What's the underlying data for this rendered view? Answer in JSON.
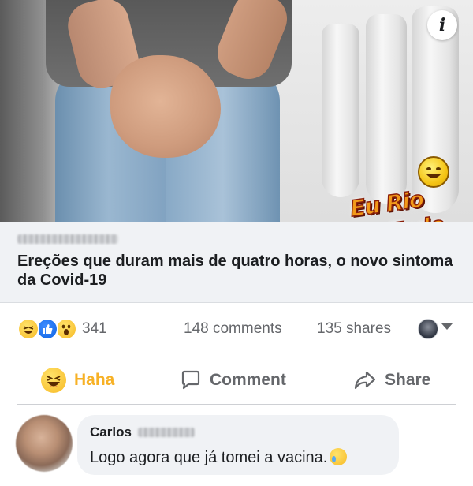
{
  "post": {
    "link_preview": {
      "domain_obscured": "",
      "title": "Ereções que duram mais de quatro horas, o novo sintoma da Covid-19"
    },
    "photo": {
      "info_icon": "i"
    },
    "watermark": {
      "line1": "Eu Rio",
      "line2": "De Tudo",
      "icon": "smiley-icon"
    },
    "stats": {
      "reaction_icons": [
        "haha-icon",
        "like-icon",
        "wow-icon"
      ],
      "reaction_count": "341",
      "comments": "148 comments",
      "shares": "135 shares"
    },
    "actions": {
      "haha_label": "Haha",
      "comment_label": "Comment",
      "share_label": "Share"
    }
  },
  "comment": {
    "author": "Carlos",
    "text": "Logo agora que já tomei a vacina.",
    "emoji": "crying-emoji"
  },
  "colors": {
    "haha_active": "#f7b125",
    "secondary_text": "#65676b",
    "bubble_bg": "#f0f2f5",
    "like_blue": "#1877f2"
  }
}
